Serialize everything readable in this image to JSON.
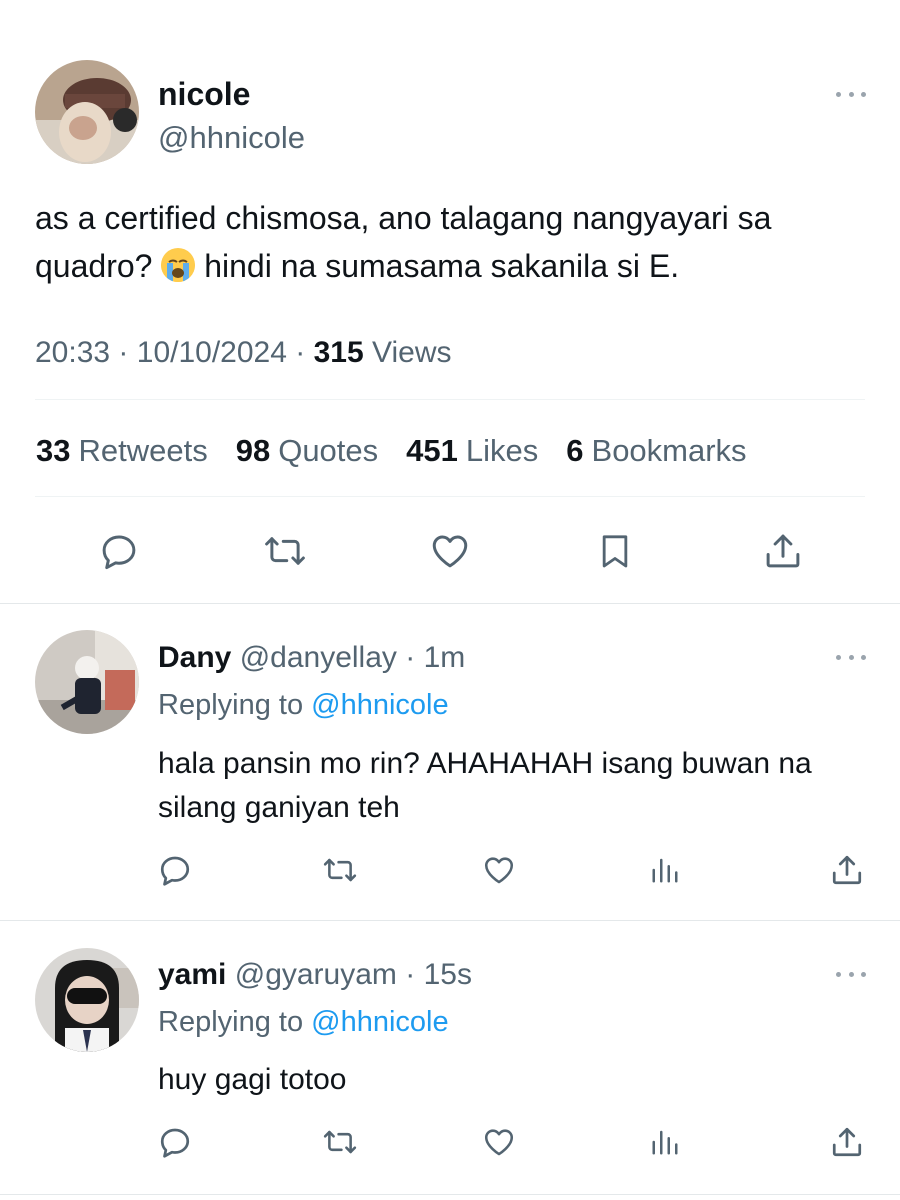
{
  "tweet": {
    "author_name": "nicole",
    "author_handle": "@hhnicole",
    "text_part1": "as a certified chismosa, ano talagang nangyayari sa",
    "text_part2_a": "quadro?",
    "text_emoji_name": "loudly-crying-face-emoji",
    "text_part2_b": "hindi na sumasama sakanila si E.",
    "time": "20:33",
    "date": "10/10/2024",
    "separator": "·",
    "views_count": "315",
    "views_label": "Views",
    "stats": [
      {
        "count": "33",
        "label": "Retweets"
      },
      {
        "count": "98",
        "label": "Quotes"
      },
      {
        "count": "451",
        "label": "Likes"
      },
      {
        "count": "6",
        "label": "Bookmarks"
      }
    ]
  },
  "replies": [
    {
      "name": "Dany",
      "handle": "@danyellay",
      "time": "· 1m",
      "replying_label": "Replying to",
      "mention": "@hhnicole",
      "text_line1": "hala pansin mo rin? AHAHAHAH isang buwan na",
      "text_line2": "silang ganiyan teh"
    },
    {
      "name": "yami",
      "handle": "@gyaruyam",
      "time": "· 15s",
      "replying_label": "Replying to",
      "mention": "@hhnicole",
      "text_line1": "huy gagi totoo",
      "text_line2": ""
    }
  ],
  "icons": {
    "reply": "reply-icon",
    "retweet": "retweet-icon",
    "like": "heart-icon",
    "bookmark": "bookmark-icon",
    "share": "share-icon",
    "views": "views-icon",
    "more": "more-icon"
  },
  "colors": {
    "text": "#0f1419",
    "secondary": "#536471",
    "link": "#1d9bf0",
    "divider": "#eff3f4"
  }
}
